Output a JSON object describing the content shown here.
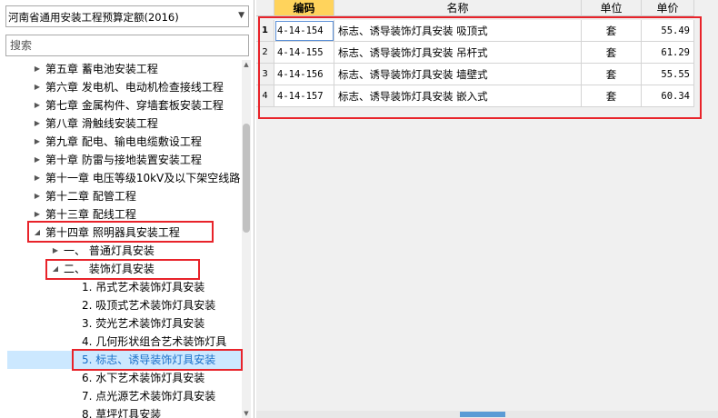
{
  "left": {
    "dropdown_value": "河南省通用安装工程预算定额(2016)",
    "search_placeholder": "搜索",
    "tree": [
      {
        "level": 0,
        "expander": "collapsed",
        "label": "第五章  蓄电池安装工程"
      },
      {
        "level": 0,
        "expander": "collapsed",
        "label": "第六章  发电机、电动机检查接线工程"
      },
      {
        "level": 0,
        "expander": "collapsed",
        "label": "第七章  金属构件、穿墙套板安装工程"
      },
      {
        "level": 0,
        "expander": "collapsed",
        "label": "第八章  滑触线安装工程"
      },
      {
        "level": 0,
        "expander": "collapsed",
        "label": "第九章  配电、输电电缆敷设工程"
      },
      {
        "level": 0,
        "expander": "collapsed",
        "label": "第十章  防雷与接地装置安装工程"
      },
      {
        "level": 0,
        "expander": "collapsed",
        "label": "第十一章  电压等级10kV及以下架空线路"
      },
      {
        "level": 0,
        "expander": "collapsed",
        "label": "第十二章  配管工程"
      },
      {
        "level": 0,
        "expander": "collapsed",
        "label": "第十三章  配线工程"
      },
      {
        "level": 0,
        "expander": "expanded",
        "label": "第十四章  照明器具安装工程"
      },
      {
        "level": 1,
        "expander": "collapsed",
        "label": "一、  普通灯具安装"
      },
      {
        "level": 1,
        "expander": "expanded",
        "label": "二、  装饰灯具安装"
      },
      {
        "level": 2,
        "expander": "none",
        "label": "1.  吊式艺术装饰灯具安装"
      },
      {
        "level": 2,
        "expander": "none",
        "label": "2.  吸顶式艺术装饰灯具安装"
      },
      {
        "level": 2,
        "expander": "none",
        "label": "3.  荧光艺术装饰灯具安装"
      },
      {
        "level": 2,
        "expander": "none",
        "label": "4.  几何形状组合艺术装饰灯具"
      },
      {
        "level": 2,
        "expander": "none",
        "label": "5.  标志、诱导装饰灯具安装",
        "selected": true
      },
      {
        "level": 2,
        "expander": "none",
        "label": "6.  水下艺术装饰灯具安装"
      },
      {
        "level": 2,
        "expander": "none",
        "label": "7.  点光源艺术装饰灯具安装"
      },
      {
        "level": 2,
        "expander": "none",
        "label": "8.  草坪灯具安装"
      }
    ]
  },
  "table": {
    "headers": {
      "code": "编码",
      "name": "名称",
      "unit": "单位",
      "price": "单价"
    },
    "rows": [
      {
        "index": "1",
        "code": "4-14-154",
        "name": "标志、诱导装饰灯具安装 吸顶式",
        "unit": "套",
        "price": "55.49"
      },
      {
        "index": "2",
        "code": "4-14-155",
        "name": "标志、诱导装饰灯具安装 吊杆式",
        "unit": "套",
        "price": "61.29"
      },
      {
        "index": "3",
        "code": "4-14-156",
        "name": "标志、诱导装饰灯具安装 墙壁式",
        "unit": "套",
        "price": "55.55"
      },
      {
        "index": "4",
        "code": "4-14-157",
        "name": "标志、诱导装饰灯具安装 嵌入式",
        "unit": "套",
        "price": "60.34"
      }
    ]
  },
  "colors": {
    "highlight_box": "#e8232a",
    "active_header": "#ffd35c",
    "selected_row": "#cce8ff",
    "selected_text": "#1a6fc9"
  },
  "icons": {
    "dropdown": "chevron-down-icon",
    "expand": "triangle-right-icon",
    "collapse": "triangle-down-icon"
  }
}
